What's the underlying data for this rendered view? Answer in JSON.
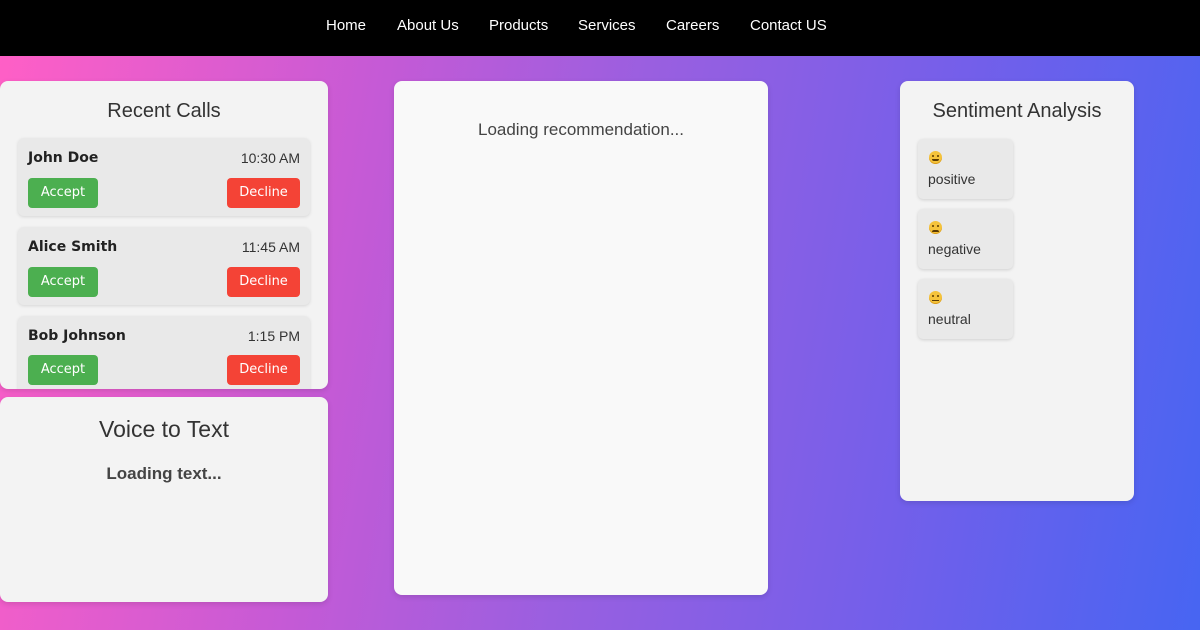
{
  "nav": {
    "items": [
      "Home",
      "About Us",
      "Products",
      "Services",
      "Careers",
      "Contact US"
    ]
  },
  "recent_calls": {
    "title": "Recent Calls",
    "calls": [
      {
        "name": "John Doe",
        "time": "10:30 AM",
        "accept": "Accept",
        "decline": "Decline"
      },
      {
        "name": "Alice Smith",
        "time": "11:45 AM",
        "accept": "Accept",
        "decline": "Decline"
      },
      {
        "name": "Bob Johnson",
        "time": "1:15 PM",
        "accept": "Accept",
        "decline": "Decline"
      }
    ]
  },
  "voice_to_text": {
    "title": "Voice to Text",
    "status": "Loading text..."
  },
  "recommendation": {
    "status": "Loading recommendation..."
  },
  "sentiment": {
    "title": "Sentiment Analysis",
    "items": [
      {
        "label": "positive",
        "icon": "smiling-face-icon"
      },
      {
        "label": "negative",
        "icon": "frowning-face-icon"
      },
      {
        "label": "neutral",
        "icon": "neutral-face-icon"
      }
    ]
  },
  "colors": {
    "accept": "#4caf50",
    "decline": "#f44336",
    "gradient_start": "#ff5fc6",
    "gradient_end": "#4765f2"
  }
}
